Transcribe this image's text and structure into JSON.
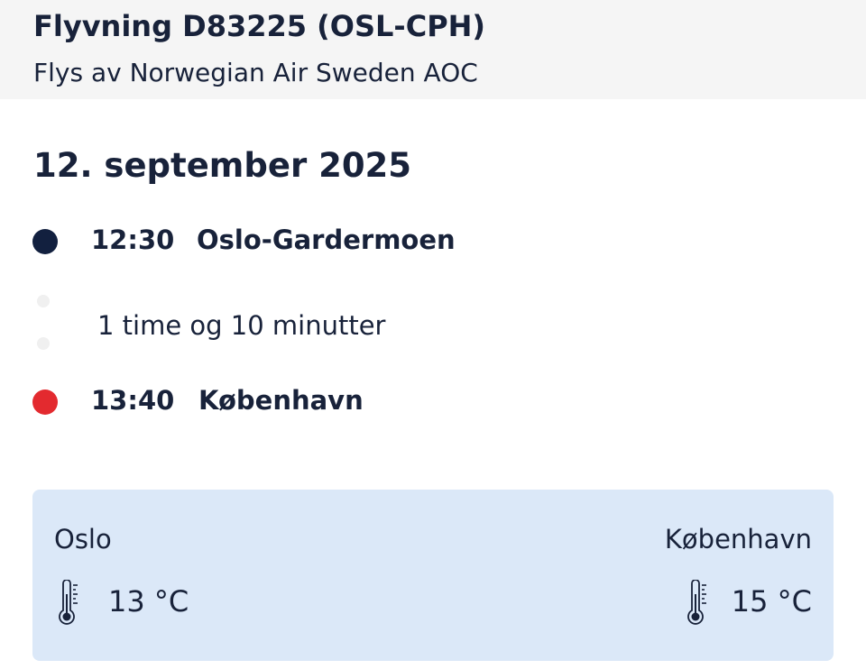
{
  "header": {
    "flight_title": "Flyvning D83225 (OSL-CPH)",
    "operator": "Flys av Norwegian Air Sweden AOC"
  },
  "date": "12. september 2025",
  "departure": {
    "time": "12:30",
    "airport": "Oslo-Gardermoen",
    "dot_color": "#12203f"
  },
  "duration": "1 time og 10 minutter",
  "arrival": {
    "time": "13:40",
    "airport": "København",
    "dot_color": "#e32a2f"
  },
  "weather": {
    "origin": {
      "city": "Oslo",
      "temperature": "13 °C",
      "icon": "thermometer-icon"
    },
    "destination": {
      "city": "København",
      "temperature": "15 °C",
      "icon": "thermometer-icon"
    },
    "background": "#dbe8f8"
  }
}
